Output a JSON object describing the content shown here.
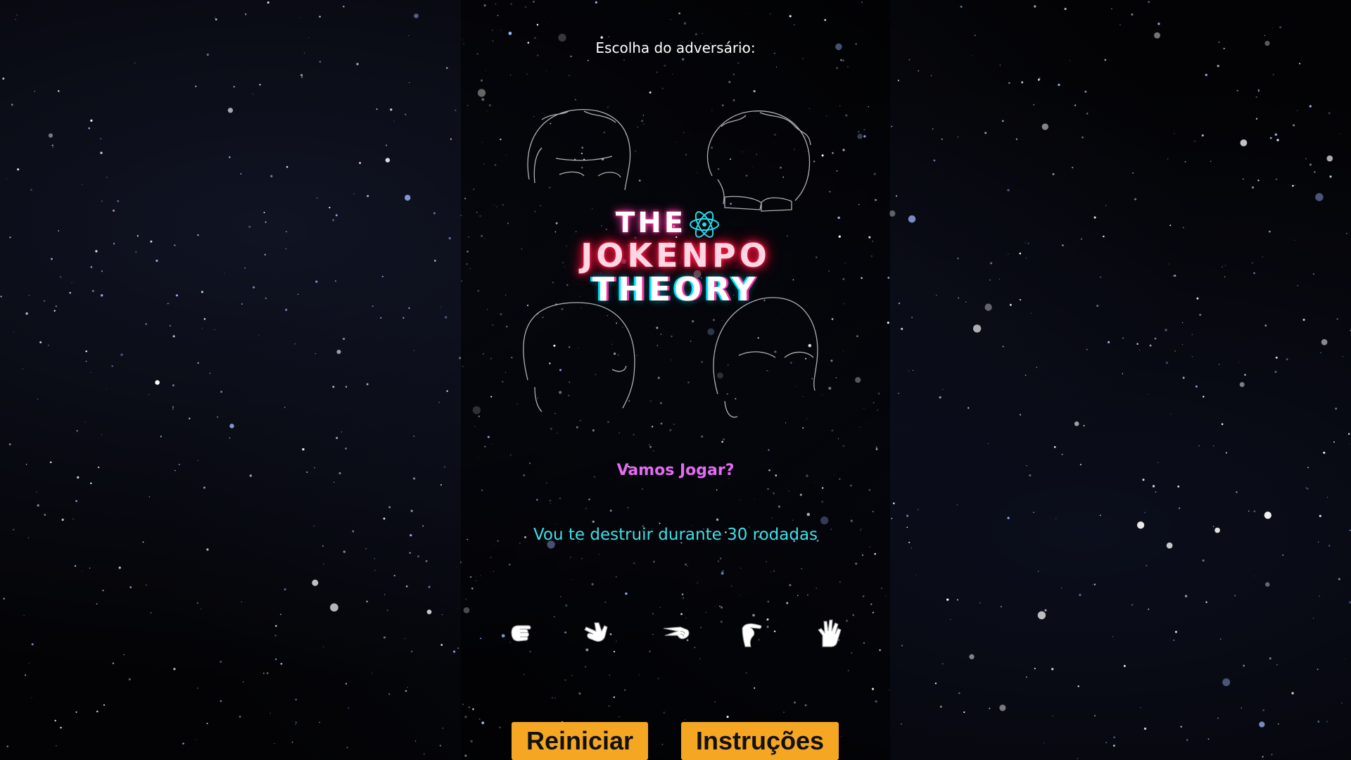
{
  "opponent_prompt": "Escolha do adversário:",
  "logo": {
    "line1": "THE",
    "line2": "JOKENPO",
    "line3": "THEORY"
  },
  "status": "Vamos Jogar?",
  "rounds_message": "Vou te destruir durante 30 rodadas",
  "moves": [
    {
      "icon": "rock-hand-icon"
    },
    {
      "icon": "paper-hand-icon"
    },
    {
      "icon": "scissors-hand-icon"
    },
    {
      "icon": "lizard-hand-icon"
    },
    {
      "icon": "spock-hand-icon"
    }
  ],
  "buttons": {
    "restart": "Reiniciar",
    "instructions": "Instruções"
  },
  "colors": {
    "status": "#e36cf0",
    "rounds": "#3fe0e6",
    "button": "#f5a623",
    "logo_pink": "#ff2f9a",
    "logo_red": "#ff1a3d",
    "logo_cyan": "#00e5ff"
  }
}
